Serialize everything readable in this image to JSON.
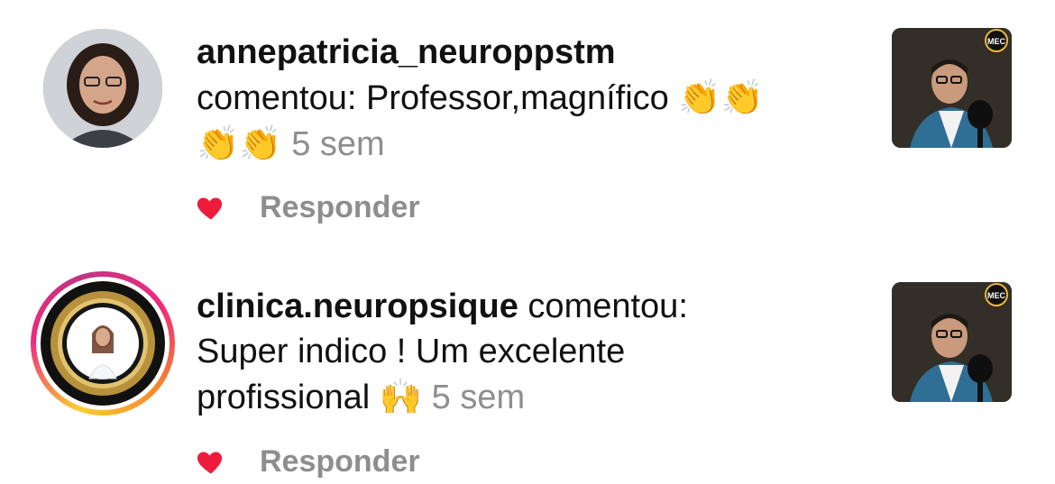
{
  "notifications": [
    {
      "username": "annepatricia_neuroppstm",
      "comment_prefix": "comentou: Professor,magnífico ",
      "emoji_first": "👏👏",
      "emoji_second": "👏👏",
      "time": "5 sem",
      "liked": true,
      "reply_label": "Responder",
      "icon": "heart-icon",
      "thumb_badge": "MEC"
    },
    {
      "username": "clinica.neuropsique",
      "comment_line1": " comentou:",
      "comment_line2": "Super indico ! Um excelente",
      "comment_line3": "profissional ",
      "emoji": "🙌",
      "time": "5 sem",
      "liked": true,
      "reply_label": "Responder",
      "icon": "heart-icon",
      "thumb_badge": "MEC"
    }
  ],
  "colors": {
    "heart": "#ed1c3c",
    "meta_text": "#8e8e8e",
    "story_ring": [
      "#f9ce34",
      "#ee2a7b",
      "#c13584"
    ]
  }
}
